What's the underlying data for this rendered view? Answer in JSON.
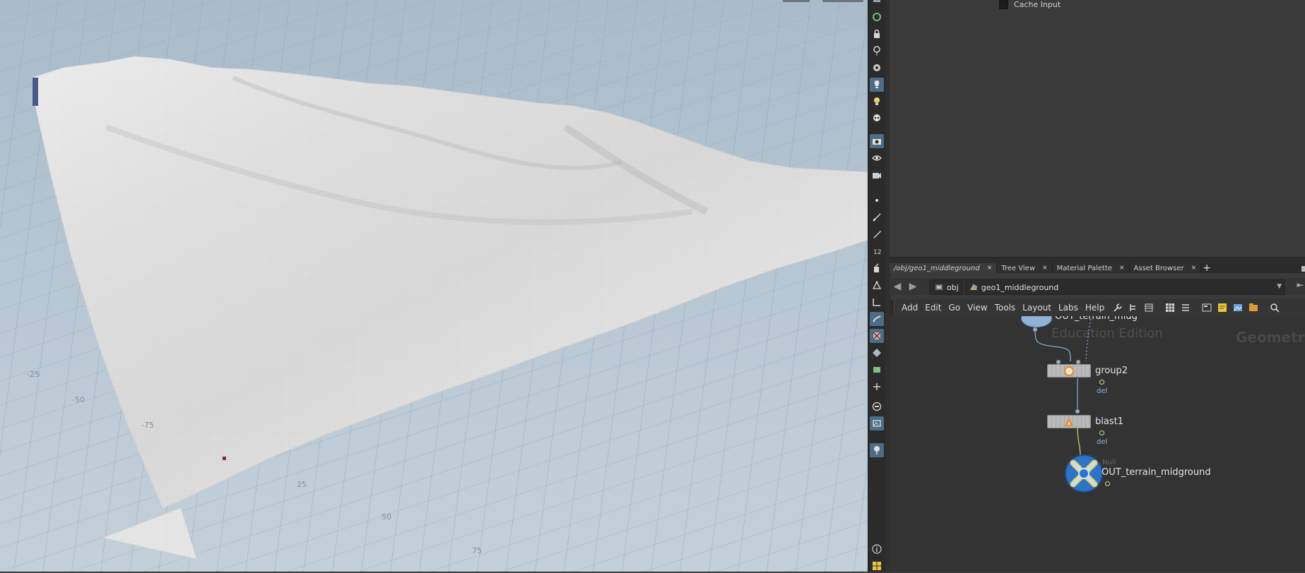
{
  "viewport": {
    "grid_labels": [
      "25",
      "50",
      "75",
      "-25",
      "-50",
      "-75"
    ]
  },
  "shelf": {
    "icons": [
      "select-icon",
      "view-icon",
      "lock-icon",
      "handle-icon",
      "snap-icon",
      "light-icon",
      "bulb-icon",
      "skull-icon",
      "camera-icon",
      "eye-icon",
      "render-icon",
      "point-icon",
      "brush-icon",
      "pen-icon",
      "number-icon",
      "paint-icon",
      "vertex-icon",
      "edge-icon",
      "sculpt-icon",
      "uv-icon",
      "shape-icon",
      "map-icon",
      "transform-icon",
      "layer-icon",
      "snapshot-icon",
      "pin-icon",
      "info-icon",
      "grid-icon"
    ]
  },
  "param_pane": {
    "cache_input_label": "Cache Input"
  },
  "tabs": [
    {
      "label": "/obj/geo1_middleground",
      "active": true
    },
    {
      "label": "Tree View",
      "active": false
    },
    {
      "label": "Material Palette",
      "active": false
    },
    {
      "label": "Asset Browser",
      "active": false
    }
  ],
  "tab_close_glyph": "×",
  "tab_add_glyph": "+",
  "pathbar": {
    "segments": [
      "obj",
      "geo1_middleground"
    ]
  },
  "menubar": {
    "items": [
      "Add",
      "Edit",
      "Go",
      "View",
      "Tools",
      "Layout",
      "Labs",
      "Help"
    ]
  },
  "network": {
    "watermark_edu": "Education Edition",
    "watermark_context": "Geometry",
    "top_node_label": "OUT_terrain_midg",
    "nodes": [
      {
        "name": "group2",
        "sub": "del"
      },
      {
        "name": "blast1",
        "sub": "del"
      },
      {
        "name": "OUT_terrain_midground",
        "type": "Null"
      }
    ]
  },
  "colors": {
    "accent": "#4d6d86",
    "wire": "#7fa9d6",
    "flag": "#c9e07a",
    "null_node": "#2f73c9"
  }
}
